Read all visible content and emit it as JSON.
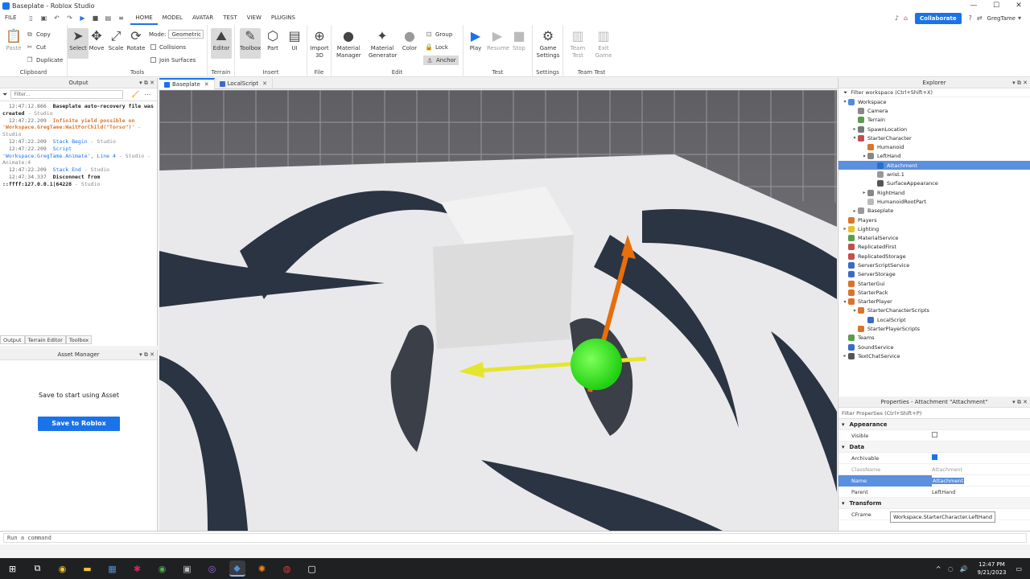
{
  "window": {
    "title": "Baseplate - Roblox Studio"
  },
  "menu": {
    "file": "FILE",
    "tabs": [
      "HOME",
      "MODEL",
      "AVATAR",
      "TEST",
      "VIEW",
      "PLUGINS"
    ],
    "collaborate": "Collaborate",
    "user": "GregTame"
  },
  "ribbon": {
    "clipboard": {
      "paste": "Paste",
      "copy": "Copy",
      "cut": "Cut",
      "duplicate": "Duplicate",
      "label": "Clipboard"
    },
    "tools": {
      "select": "Select",
      "move": "Move",
      "scale": "Scale",
      "rotate": "Rotate",
      "mode_label": "Mode:",
      "mode_value": "Geometric",
      "collisions": "Collisions",
      "join_surfaces": "Join Surfaces",
      "label": "Tools"
    },
    "terrain": {
      "editor": "Editor",
      "label": "Terrain"
    },
    "insert": {
      "toolbox": "Toolbox",
      "part": "Part",
      "ui": "UI",
      "label": "Insert"
    },
    "file": {
      "import3d": "Import 3D",
      "label": "File"
    },
    "edit": {
      "material_manager": "Material Manager",
      "material_generator": "Material Generator",
      "color": "Color",
      "group": "Group",
      "lock": "Lock",
      "anchor": "Anchor",
      "label": "Edit"
    },
    "test": {
      "play": "Play",
      "resume": "Resume",
      "stop": "Stop",
      "label": "Test"
    },
    "settings": {
      "game_settings": "Game Settings",
      "label": "Settings"
    },
    "team_test": {
      "team_test": "Team Test",
      "exit_game": "Exit Game",
      "label": "Team Test"
    }
  },
  "output": {
    "title": "Output",
    "filter_placeholder": "Filter...",
    "log": [
      {
        "ts": "12:47:12.866",
        "msg": "Baseplate auto-recovery file was created",
        "src": " - Studio",
        "style": "bold"
      },
      {
        "ts": "12:47:22.209",
        "msg": "Infinite yield possible on 'Workspace.GregTame:WaitForChild(\"Torso\")'",
        "src": " - Studio",
        "style": "warn"
      },
      {
        "ts": "12:47:22.209",
        "msg": "Stack Begin",
        "src": " - Studio",
        "style": "info"
      },
      {
        "ts": "12:47:22.209",
        "msg": "Script 'Workspace.GregTame.Animate', Line 4",
        "src": " - Studio - Animate:4",
        "style": "info"
      },
      {
        "ts": "12:47:22.209",
        "msg": "Stack End",
        "src": " - Studio",
        "style": "info"
      },
      {
        "ts": "12:47:34.337",
        "msg": "Disconnect from ::ffff:127.0.0.1|64228",
        "src": " - Studio",
        "style": "bold"
      }
    ],
    "tabs": [
      "Output",
      "Terrain Editor",
      "Toolbox"
    ]
  },
  "asset_manager": {
    "title": "Asset Manager",
    "message": "Save to start using Asset",
    "button": "Save to Roblox"
  },
  "doc_tabs": [
    {
      "label": "Baseplate",
      "color": "#1a73e8"
    },
    {
      "label": "LocalScript",
      "color": "#3b6bc9"
    }
  ],
  "explorer": {
    "title": "Explorer",
    "filter": "Filter workspace (Ctrl+Shift+X)",
    "items": [
      {
        "label": "Workspace",
        "depth": 0,
        "tw": "▾",
        "color": "#4a90d9"
      },
      {
        "label": "Camera",
        "depth": 1,
        "tw": "",
        "color": "#888"
      },
      {
        "label": "Terrain",
        "depth": 1,
        "tw": "",
        "color": "#5a9e4b"
      },
      {
        "label": "SpawnLocation",
        "depth": 1,
        "tw": "▸",
        "color": "#777"
      },
      {
        "label": "StarterCharacter",
        "depth": 1,
        "tw": "▾",
        "color": "#c0504d"
      },
      {
        "label": "Humanoid",
        "depth": 2,
        "tw": "",
        "color": "#d9742b"
      },
      {
        "label": "LeftHand",
        "depth": 2,
        "tw": "▾",
        "color": "#888"
      },
      {
        "label": "Attachment",
        "depth": 3,
        "tw": "",
        "color": "#2b6fcf",
        "selected": true
      },
      {
        "label": "wrist.1",
        "depth": 3,
        "tw": "",
        "color": "#999"
      },
      {
        "label": "SurfaceAppearance",
        "depth": 3,
        "tw": "",
        "color": "#555"
      },
      {
        "label": "RightHand",
        "depth": 2,
        "tw": "▸",
        "color": "#888"
      },
      {
        "label": "HumanoidRootPart",
        "depth": 2,
        "tw": "",
        "color": "#bbb"
      },
      {
        "label": "Baseplate",
        "depth": 1,
        "tw": "▸",
        "color": "#999"
      },
      {
        "label": "Players",
        "depth": 0,
        "tw": "",
        "color": "#d9742b"
      },
      {
        "label": "Lighting",
        "depth": 0,
        "tw": "▸",
        "color": "#e8c22b"
      },
      {
        "label": "MaterialService",
        "depth": 0,
        "tw": "",
        "color": "#5a9e4b"
      },
      {
        "label": "ReplicatedFirst",
        "depth": 0,
        "tw": "",
        "color": "#c0504d"
      },
      {
        "label": "ReplicatedStorage",
        "depth": 0,
        "tw": "",
        "color": "#c0504d"
      },
      {
        "label": "ServerScriptService",
        "depth": 0,
        "tw": "",
        "color": "#3b6bc9"
      },
      {
        "label": "ServerStorage",
        "depth": 0,
        "tw": "",
        "color": "#3b6bc9"
      },
      {
        "label": "StarterGui",
        "depth": 0,
        "tw": "",
        "color": "#d9742b"
      },
      {
        "label": "StarterPack",
        "depth": 0,
        "tw": "",
        "color": "#d9742b"
      },
      {
        "label": "StarterPlayer",
        "depth": 0,
        "tw": "▾",
        "color": "#d9742b"
      },
      {
        "label": "StarterCharacterScripts",
        "depth": 1,
        "tw": "▾",
        "color": "#d9742b"
      },
      {
        "label": "LocalScript",
        "depth": 2,
        "tw": "",
        "color": "#3b6bc9"
      },
      {
        "label": "StarterPlayerScripts",
        "depth": 1,
        "tw": "",
        "color": "#d9742b"
      },
      {
        "label": "Teams",
        "depth": 0,
        "tw": "",
        "color": "#5a9e4b"
      },
      {
        "label": "SoundService",
        "depth": 0,
        "tw": "",
        "color": "#3b6bc9"
      },
      {
        "label": "TextChatService",
        "depth": 0,
        "tw": "▸",
        "color": "#555"
      }
    ]
  },
  "properties": {
    "title": "Properties - Attachment \"Attachment\"",
    "filter": "Filter Properties (Ctrl+Shift+P)",
    "appearance_label": "Appearance",
    "visible_label": "Visible",
    "data_label": "Data",
    "archivable_label": "Archivable",
    "classname_label": "ClassName",
    "classname_value": "Attachment",
    "name_label": "Name",
    "name_value": "Attachment",
    "parent_label": "Parent",
    "parent_value": "LeftHand",
    "transform_label": "Transform",
    "cframe_label": "CFrame",
    "tooltip": "Workspace.StarterCharacter.LeftHand"
  },
  "command": {
    "placeholder": "Run a command"
  },
  "taskbar": {
    "time": "12:47 PM",
    "date": "9/21/2023"
  }
}
